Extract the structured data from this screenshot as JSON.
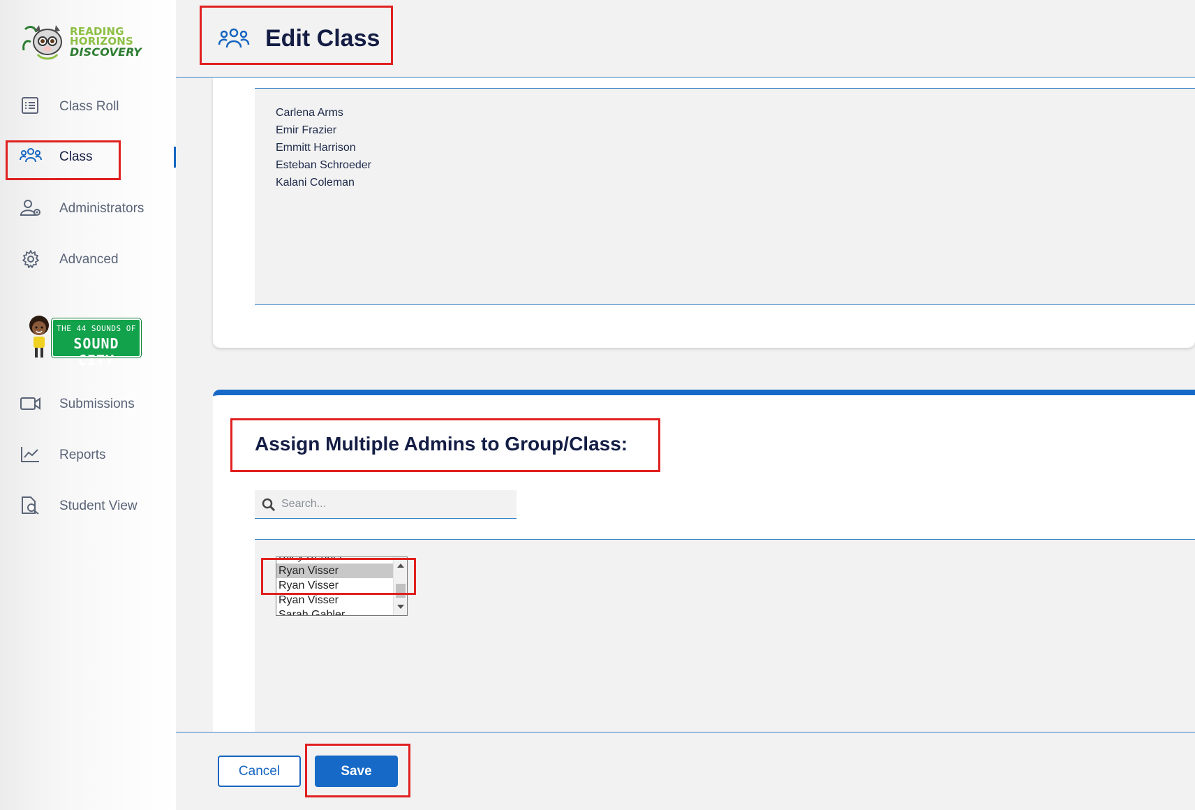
{
  "sidebar": {
    "logo_lines": [
      "READING",
      "HORIZONS",
      "DISCOVERY"
    ],
    "items": [
      {
        "label": "Class Roll",
        "icon": "list-icon"
      },
      {
        "label": "Class",
        "icon": "group-icon",
        "active": true
      },
      {
        "label": "Administrators",
        "icon": "user-gear-icon"
      },
      {
        "label": "Advanced",
        "icon": "gear-icon"
      }
    ],
    "sound_city": {
      "line1": "THE 44 SOUNDS OF",
      "line2": "SOUND CITY"
    },
    "items2": [
      {
        "label": "Submissions",
        "icon": "video-icon"
      },
      {
        "label": "Reports",
        "icon": "chart-line-icon"
      },
      {
        "label": "Student View",
        "icon": "document-search-icon"
      }
    ]
  },
  "header": {
    "title": "Edit Class",
    "icon": "group-icon"
  },
  "students": [
    "Carlena Arms",
    "Emir Frazier",
    "Emmitt Harrison",
    "Esteban Schroeder",
    "Kalani Coleman"
  ],
  "admins": {
    "title": "Assign Multiple Admins to Group/Class:",
    "search_placeholder": "Search...",
    "options": [
      "Riley Renner",
      "Ryan Visser",
      "Ryan Visser",
      "Ryan Visser",
      "Sarah Gabler"
    ],
    "selected_index": 1
  },
  "footer": {
    "cancel_label": "Cancel",
    "save_label": "Save"
  },
  "colors": {
    "accent": "#1669c6",
    "title": "#141d44",
    "annotation": "#e02020"
  }
}
